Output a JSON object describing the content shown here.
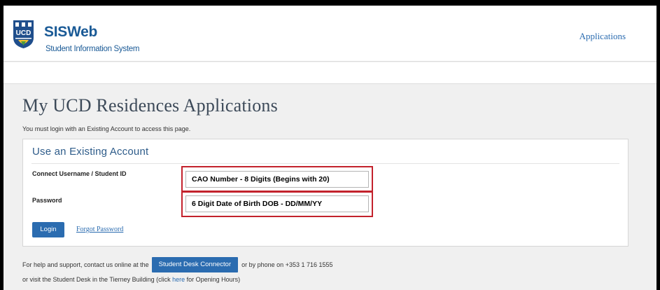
{
  "header": {
    "logo_text": "UCD",
    "brand": "SISWeb",
    "tagline": "Student Information System",
    "nav_applications": "Applications"
  },
  "page": {
    "title": "My UCD Residences Applications",
    "login_note": "You must login with an Existing Account to access this page."
  },
  "panel": {
    "title": "Use an Existing Account",
    "username_label": "Connect Username / Student ID",
    "username_value": "CAO Number - 8 Digits (Begins with 20)",
    "password_label": "Password",
    "password_value": "6 Digit Date of Birth DOB - DD/MM/YY",
    "login_label": "Login",
    "forgot_label": "Forgot Password"
  },
  "help": {
    "prefix": "For help and support, contact us online at the",
    "connector_label": "Student Desk Connector",
    "suffix": "or by phone on +353 1 716 1555",
    "line2_prefix": "or visit the Student Desk in the Tierney Building (click ",
    "here_label": "here",
    "line2_suffix": " for Opening Hours)"
  },
  "colors": {
    "brand_blue": "#1a5a96",
    "button_blue": "#2b6cb0",
    "highlight_red": "#c3222c"
  }
}
